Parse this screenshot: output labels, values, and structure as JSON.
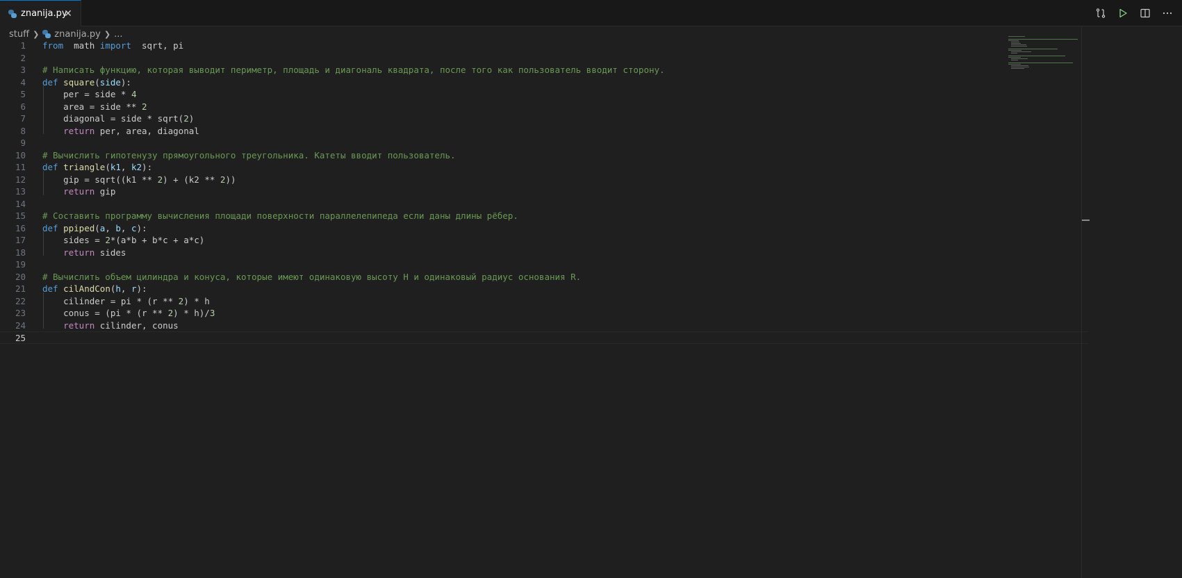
{
  "tab": {
    "label": "znanija.py",
    "close_glyph": "✕"
  },
  "actions": [
    {
      "name": "compare-changes-icon"
    },
    {
      "name": "run-file-icon"
    },
    {
      "name": "split-editor-icon"
    },
    {
      "name": "more-actions-icon"
    }
  ],
  "breadcrumb": {
    "folder": "stuff",
    "file": "znanija.py",
    "ellipsis": "..."
  },
  "code_lines": [
    {
      "n": "1",
      "t": [
        [
          "kw",
          "from"
        ],
        [
          "",
          "  math "
        ],
        [
          "kw",
          "import"
        ],
        [
          "",
          "  sqrt, pi"
        ]
      ]
    },
    {
      "n": "2",
      "t": []
    },
    {
      "n": "3",
      "t": [
        [
          "com",
          "# Написать функцию, которая выводит периметр, площадь и диагональ квадрата, после того как пользователь вводит сторону."
        ]
      ]
    },
    {
      "n": "4",
      "t": [
        [
          "kw",
          "def"
        ],
        [
          "",
          " "
        ],
        [
          "fn",
          "square"
        ],
        [
          "",
          "("
        ],
        [
          "param",
          "side"
        ],
        [
          "",
          "):"
        ]
      ]
    },
    {
      "n": "5",
      "t": [
        [
          "",
          "    per = side * "
        ],
        [
          "num",
          "4"
        ]
      ]
    },
    {
      "n": "6",
      "t": [
        [
          "",
          "    area = side ** "
        ],
        [
          "num",
          "2"
        ]
      ]
    },
    {
      "n": "7",
      "t": [
        [
          "",
          "    diagonal = side * sqrt("
        ],
        [
          "num",
          "2"
        ],
        [
          "",
          ")"
        ]
      ]
    },
    {
      "n": "8",
      "t": [
        [
          "",
          "    "
        ],
        [
          "ctl",
          "return"
        ],
        [
          "",
          " per, area, diagonal"
        ]
      ]
    },
    {
      "n": "9",
      "t": []
    },
    {
      "n": "10",
      "t": [
        [
          "com",
          "# Вычислить гипотенузу прямоугольного треугольника. Катеты вводит пользователь."
        ]
      ]
    },
    {
      "n": "11",
      "t": [
        [
          "kw",
          "def"
        ],
        [
          "",
          " "
        ],
        [
          "fn",
          "triangle"
        ],
        [
          "",
          "("
        ],
        [
          "param",
          "k1"
        ],
        [
          "",
          ", "
        ],
        [
          "param",
          "k2"
        ],
        [
          "",
          "):"
        ]
      ]
    },
    {
      "n": "12",
      "t": [
        [
          "",
          "    gip = sqrt((k1 ** "
        ],
        [
          "num",
          "2"
        ],
        [
          "",
          ") + (k2 ** "
        ],
        [
          "num",
          "2"
        ],
        [
          "",
          "))"
        ]
      ]
    },
    {
      "n": "13",
      "t": [
        [
          "",
          "    "
        ],
        [
          "ctl",
          "return"
        ],
        [
          "",
          " gip"
        ]
      ]
    },
    {
      "n": "14",
      "t": []
    },
    {
      "n": "15",
      "t": [
        [
          "com",
          "# Составить программу вычисления площади поверхности параллелепипеда если даны длины рёбер."
        ]
      ]
    },
    {
      "n": "16",
      "t": [
        [
          "kw",
          "def"
        ],
        [
          "",
          " "
        ],
        [
          "fn",
          "ppiped"
        ],
        [
          "",
          "("
        ],
        [
          "param",
          "a"
        ],
        [
          "",
          ", "
        ],
        [
          "param",
          "b"
        ],
        [
          "",
          ", "
        ],
        [
          "param",
          "c"
        ],
        [
          "",
          "):"
        ]
      ]
    },
    {
      "n": "17",
      "t": [
        [
          "",
          "    sides = "
        ],
        [
          "num",
          "2"
        ],
        [
          "",
          "*(a*b + b*c + a*c)"
        ]
      ]
    },
    {
      "n": "18",
      "t": [
        [
          "",
          "    "
        ],
        [
          "ctl",
          "return"
        ],
        [
          "",
          " sides"
        ]
      ]
    },
    {
      "n": "19",
      "t": []
    },
    {
      "n": "20",
      "t": [
        [
          "com",
          "# Вычислить объем цилиндра и конуса, которые имеют одинаковую высоту H и одинаковый радиус основания R."
        ]
      ]
    },
    {
      "n": "21",
      "t": [
        [
          "kw",
          "def"
        ],
        [
          "",
          " "
        ],
        [
          "fn",
          "cilAndCon"
        ],
        [
          "",
          "("
        ],
        [
          "param",
          "h"
        ],
        [
          "",
          ", "
        ],
        [
          "param",
          "r"
        ],
        [
          "",
          "):"
        ]
      ]
    },
    {
      "n": "22",
      "t": [
        [
          "",
          "    cilinder = pi * (r ** "
        ],
        [
          "num",
          "2"
        ],
        [
          "",
          ") * h"
        ]
      ]
    },
    {
      "n": "23",
      "t": [
        [
          "",
          "    conus = (pi * (r ** "
        ],
        [
          "num",
          "2"
        ],
        [
          "",
          ") * h)/"
        ],
        [
          "num",
          "3"
        ]
      ]
    },
    {
      "n": "24",
      "t": [
        [
          "",
          "    "
        ],
        [
          "ctl",
          "return"
        ],
        [
          "",
          " cilinder, conus"
        ]
      ]
    },
    {
      "n": "25",
      "t": []
    }
  ],
  "current_line": "25"
}
